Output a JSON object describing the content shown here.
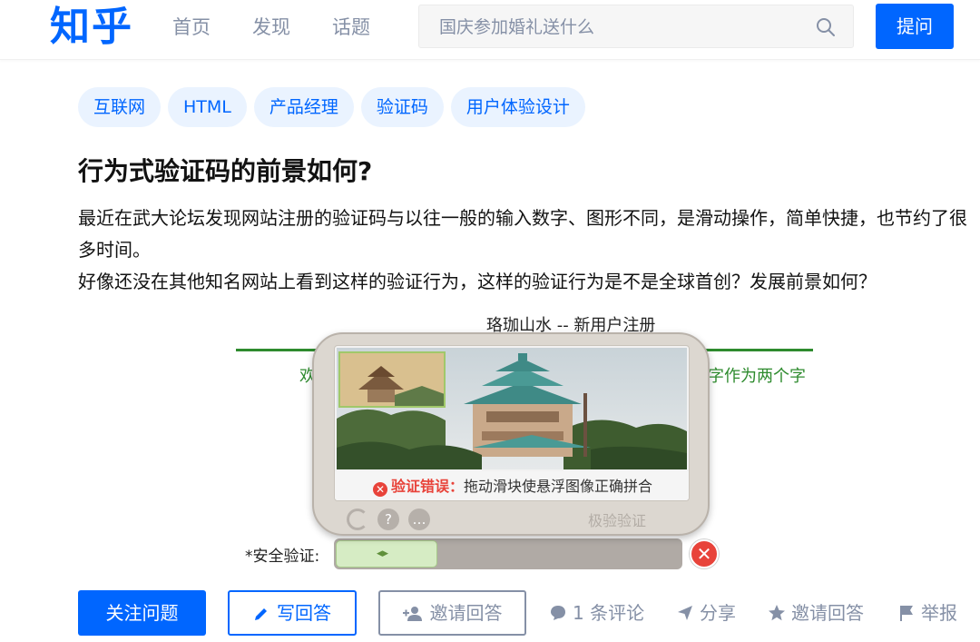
{
  "header": {
    "logo": "知乎",
    "nav": [
      "首页",
      "发现",
      "话题"
    ],
    "search_placeholder": "国庆参加婚礼送什么",
    "ask_label": "提问"
  },
  "tags": [
    "互联网",
    "HTML",
    "产品经理",
    "验证码",
    "用户体验设计"
  ],
  "question": {
    "title": "行为式验证码的前景如何?",
    "body_line1": "最近在武大论坛发现网站注册的验证码与以往一般的输入数字、图形不同，是滑动操作，简单快捷，也节约了很多时间。",
    "body_line2": "好像还没在其他知名网站上看到这样的验证行为，这样的验证行为是不是全球首创？发展前景如何？"
  },
  "embed": {
    "title": "珞珈山水 -- 新用户注册",
    "left_fragment": "欢",
    "right_fragment": "字作为两个字",
    "security_label": "*安全验证:",
    "error_strong": "验证错误：",
    "error_msg": "拖动滑块使悬浮图像正确拼合",
    "brand": "极验验证",
    "handle_grip": "◂▸"
  },
  "actions": {
    "follow": "关注问题",
    "write_answer": "写回答",
    "invite_answer_btn": "邀请回答",
    "comments": "1 条评论",
    "share": "分享",
    "invite_answer": "邀请回答",
    "report": "举报"
  },
  "colors": {
    "brand_blue": "#0066ff",
    "meta_gray": "#8590a6",
    "tag_bg": "#eaf3ff",
    "error_red": "#e8433a"
  }
}
